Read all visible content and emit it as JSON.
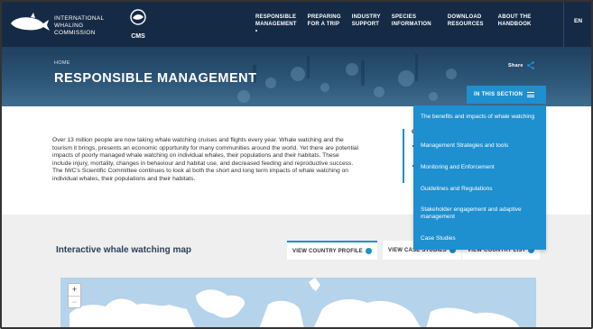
{
  "header": {
    "brand_line1": "International",
    "brand_line2": "Whaling Commission",
    "partner_logo": "CMS",
    "nav": [
      {
        "line1": "Responsible",
        "line2": "Management"
      },
      {
        "line1": "Preparing",
        "line2": "for a trip"
      },
      {
        "line1": "Industry",
        "line2": "Support"
      },
      {
        "line1": "Species",
        "line2": "Information"
      },
      {
        "line1": "Download",
        "line2": "Resources"
      },
      {
        "line1": "About the",
        "line2": "Handbook"
      }
    ],
    "language": "EN"
  },
  "hero": {
    "breadcrumb": "Home",
    "title": "Responsible Management",
    "share_label": "Share",
    "share_icon": "share-icon"
  },
  "section_menu": {
    "button_label": "In this section",
    "items": [
      "The benefits and impacts of whale watching",
      "Management Strategies and tools",
      "Monitoring and Enforcement",
      "Guidelines and Regulations",
      "Stakeholder engagement and adaptive management",
      "Case Studies"
    ]
  },
  "intro": {
    "paragraph": "Over 13 million people  are now taking whale watching cruises and flights every year.  Whale watching and the tourism it brings, presents an economic opportunity for many communities around the world. Yet there are potential impacts of poorly managed whale watching on individual whales, their populations and their habitats. These include injury, mortality, changes in behaviour and habitat use, and decreased feeding and reproductive success.  The IWC's Scientific Committee continues to look at both the short and long term impacts of whale watching on individual whales, their populations and their habitats.",
    "side_heading": "G"
  },
  "map": {
    "title": "Interactive whale watching map",
    "buttons": [
      "View country profile",
      "View case studies",
      "View country list"
    ],
    "zoom_in": "+",
    "zoom_out": "−"
  },
  "colors": {
    "nav_bg": "#152a45",
    "accent": "#1e8fcf",
    "map_water": "#b5d3ea",
    "map_land": "#ffffff"
  }
}
